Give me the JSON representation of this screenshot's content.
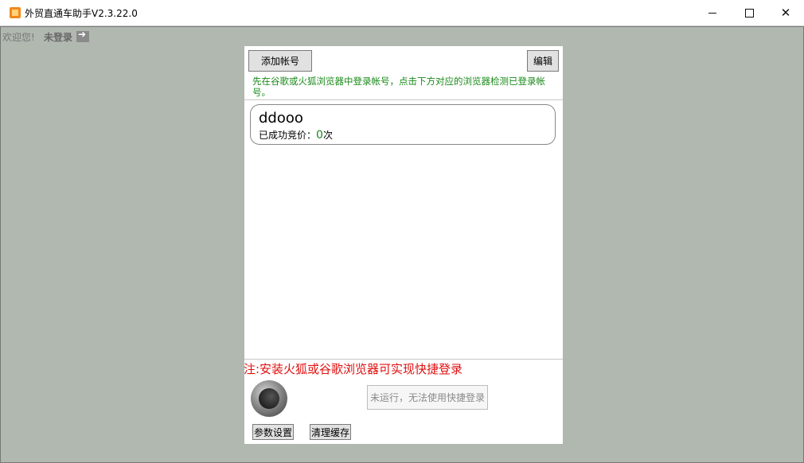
{
  "window": {
    "title": "外贸直通车助手V2.3.22.0"
  },
  "header": {
    "welcome": "欢迎您!",
    "login_status": "未登录"
  },
  "panel": {
    "add_account_label": "添加帐号",
    "edit_label": "编辑",
    "hint": "先在谷歌或火狐浏览器中登录帐号，点击下方对应的浏览器检测已登录帐号。",
    "accounts": [
      {
        "name": "ddooo",
        "stats_label": "已成功竞价：",
        "count": "0",
        "unit": "次"
      }
    ],
    "note": "注:安装火狐或谷歌浏览器可实现快捷登录",
    "quick_login_label": "未运行，无法使用快捷登录",
    "settings_label": "参数设置",
    "clear_cache_label": "清理缓存"
  }
}
